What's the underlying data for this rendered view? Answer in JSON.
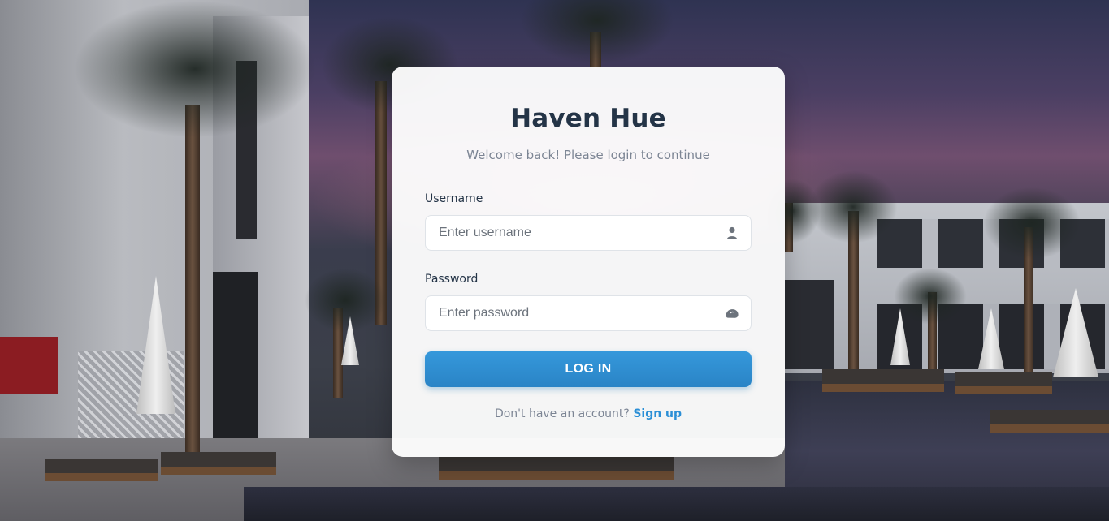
{
  "app": {
    "title": "Haven Hue",
    "subtitle": "Welcome back! Please login to continue"
  },
  "form": {
    "username": {
      "label": "Username",
      "placeholder": "Enter username",
      "value": "",
      "icon": "user-icon"
    },
    "password": {
      "label": "Password",
      "placeholder": "Enter password",
      "value": "",
      "icon": "eye-toggle-icon"
    },
    "submit_label": "LOG IN"
  },
  "footer": {
    "prompt": "Don't have an account?",
    "link_label": "Sign up"
  },
  "colors": {
    "title": "#243447",
    "accent": "#2b8fd6",
    "button": "#3598db",
    "muted_text": "#7c8594"
  }
}
